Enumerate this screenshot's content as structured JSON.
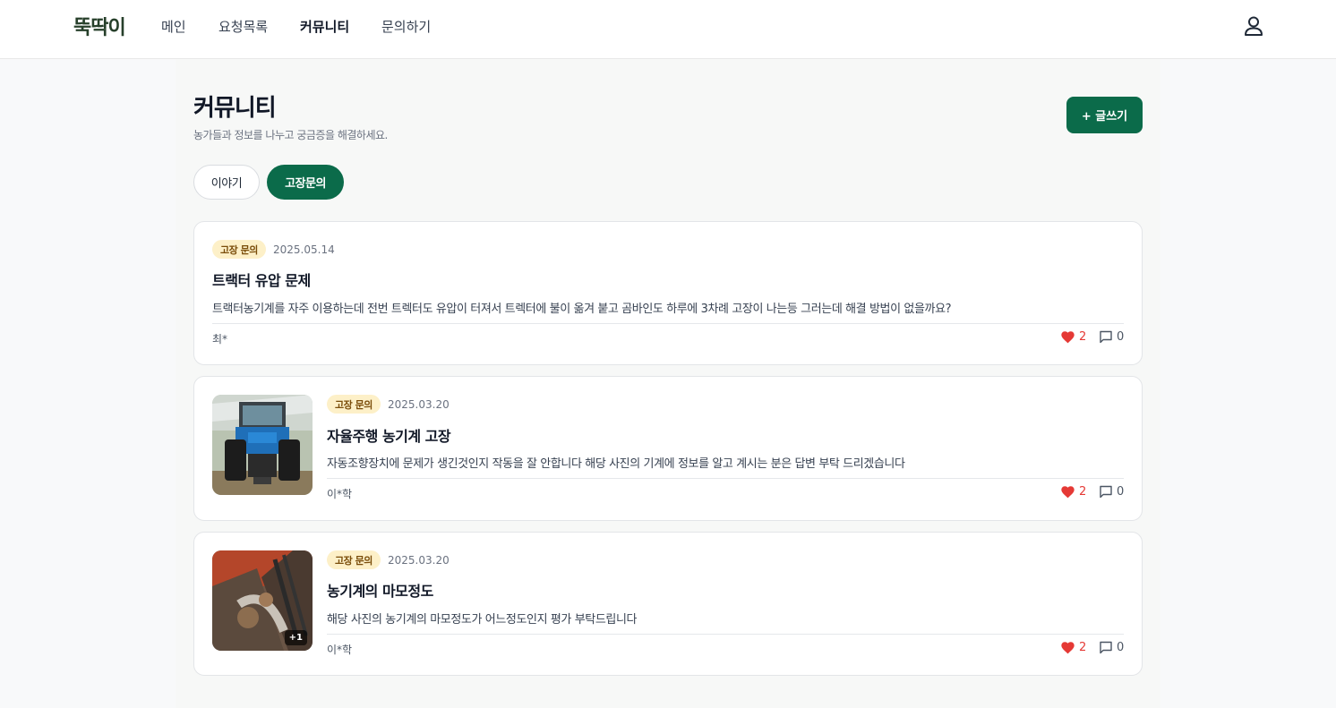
{
  "header": {
    "logo": "뚝딱이",
    "nav": [
      "메인",
      "요청목록",
      "커뮤니티",
      "문의하기"
    ],
    "active_nav": "커뮤니티"
  },
  "page": {
    "title": "커뮤니티",
    "subtitle": "농가들과 정보를 나누고 궁금증을 해결하세요.",
    "write_button": "+ 글쓰기"
  },
  "tabs": [
    {
      "label": "이야기",
      "active": false
    },
    {
      "label": "고장문의",
      "active": true
    }
  ],
  "posts": [
    {
      "badge": "고장 문의",
      "date": "2025.05.14",
      "title": "트랙터 유압 문제",
      "body": "트랙터농기계를 자주 이용하는데 전번 트렉터도 유압이 터져서 트렉터에 불이 옮겨 붙고   곰바인도 하루에 3차례 고장이 나는등  그러는데 해결 방법이 없을까요?",
      "author": "최*",
      "likes": "2",
      "comments": "0"
    },
    {
      "badge": "고장 문의",
      "date": "2025.03.20",
      "title": "자율주행 농기계 고장",
      "body": "자동조향장치에 문제가 생긴것인지 작동을 잘 안합니다 해당 사진의 기계에 정보를 알고 계시는 분은 답변 부탁 드리겠습니다",
      "author": "이*학",
      "likes": "2",
      "comments": "0"
    },
    {
      "badge": "고장 문의",
      "date": "2025.03.20",
      "title": "농기계의 마모정도",
      "body": "해당 사진의 농기계의 마모정도가 어느정도인지 평가 부탁드립니다",
      "author": "이*학",
      "likes": "2",
      "comments": "0",
      "extra_images": "+1"
    }
  ],
  "colors": {
    "brand": "#0b6b4a",
    "badge_bg": "#fdf0c8",
    "like": "#e53935"
  },
  "icons": {
    "user": "user-icon",
    "like": "heart-icon",
    "comment": "comment-icon"
  }
}
